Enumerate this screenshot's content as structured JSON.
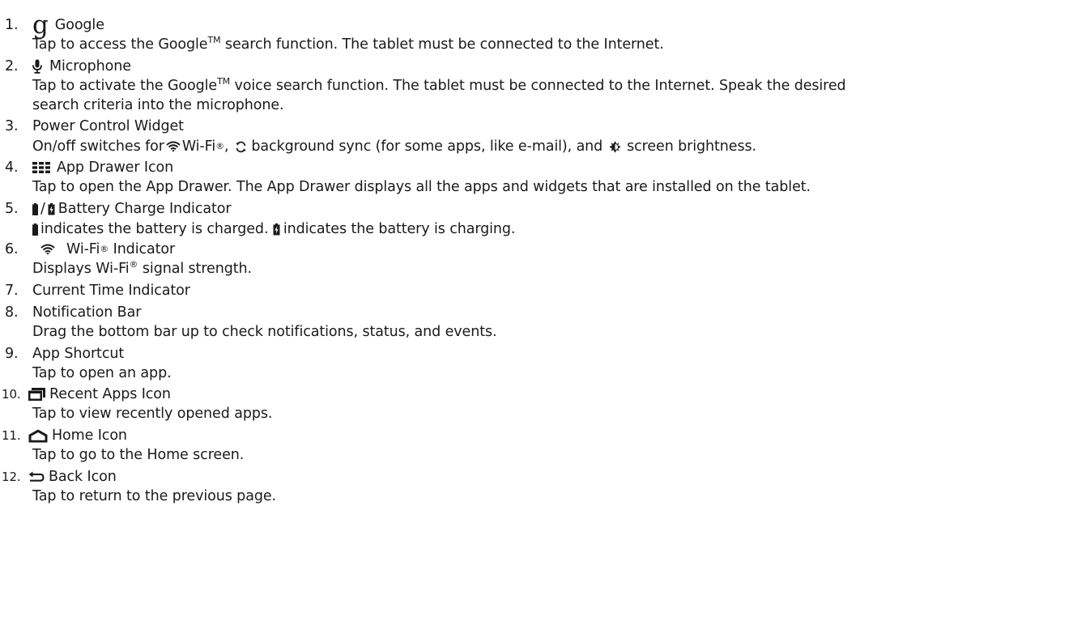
{
  "items": [
    {
      "num": "1.",
      "title": "Google",
      "desc_part1": "Tap to access the Google",
      "tm": "TM",
      "desc_part2": " search function. The tablet must be connected to the Internet."
    },
    {
      "num": "2.",
      "title": "Microphone",
      "desc_part1": "Tap to activate the Google",
      "tm": "TM",
      "desc_part2": " voice search function. The tablet must be connected to the Internet. Speak the desired",
      "desc_line2": "search criteria into the microphone."
    },
    {
      "num": "3.",
      "title": "Power Control Widget",
      "desc_a": "On/off switches for ",
      "desc_wifi": " Wi-Fi",
      "reg": "®",
      "desc_b": ", ",
      "desc_sync": " background sync (for some apps, like e-mail), and ",
      "desc_bright": " screen brightness."
    },
    {
      "num": "4.",
      "title": "App Drawer Icon",
      "desc": "Tap to open the App Drawer. The App Drawer displays all the apps and widgets that are installed on the tablet."
    },
    {
      "num": "5.",
      "title_sep": "/",
      "title": "Battery Charge Indicator",
      "desc_a": "indicates the battery is charged. ",
      "desc_b": "indicates the battery is charging."
    },
    {
      "num": "6.",
      "title_a": "Wi-Fi",
      "reg": "®",
      "title_b": " Indicator",
      "desc_a": "Displays Wi-Fi",
      "desc_b": " signal strength."
    },
    {
      "num": "7.",
      "title": "Current Time Indicator"
    },
    {
      "num": "8.",
      "title": "Notification Bar",
      "desc": "Drag the bottom bar up to check notifications, status, and events."
    },
    {
      "num": "9.",
      "title": "App Shortcut",
      "desc": "Tap to open an app."
    },
    {
      "num": "10.",
      "title": "Recent Apps Icon",
      "desc": "Tap to view recently opened apps."
    },
    {
      "num": "11.",
      "title": "Home Icon",
      "desc": "Tap to go to the Home screen."
    },
    {
      "num": "12.",
      "title": "Back Icon",
      "desc": "Tap to return to the previous page."
    }
  ],
  "google_glyph": "g",
  "icons": {
    "item1": "google-g-icon",
    "item2": "microphone-icon",
    "item3_wifi": "wifi-icon",
    "item3_sync": "sync-icon",
    "item3_brightness": "brightness-icon",
    "item4": "app-drawer-icon",
    "item5_charged": "battery-charged-icon",
    "item5_charging": "battery-charging-icon",
    "item6": "wifi-icon",
    "item10": "recent-apps-icon",
    "item11": "home-icon",
    "item12": "back-icon"
  },
  "colors": {
    "text": "#1a1a1a",
    "icon": "#1a1a1a"
  }
}
